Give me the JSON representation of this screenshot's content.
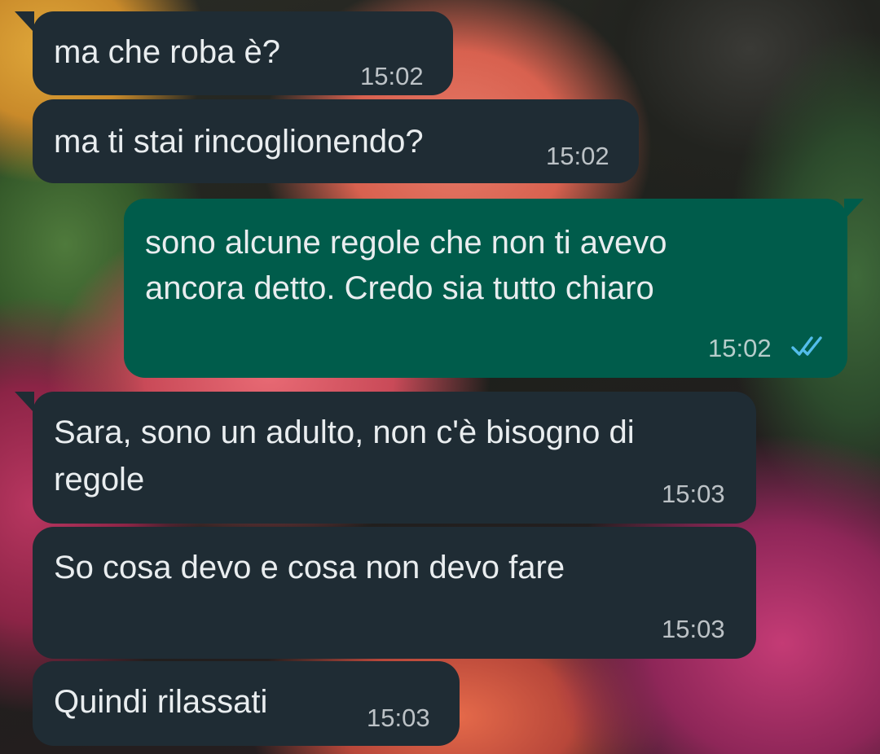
{
  "chat": {
    "messages": [
      {
        "direction": "in",
        "text_lines": [
          "ma che roba è?"
        ],
        "time": "15:02"
      },
      {
        "direction": "in",
        "text_lines": [
          "ma ti stai rincoglionendo?"
        ],
        "time": "15:02"
      },
      {
        "direction": "out",
        "text_lines": [
          "sono alcune regole che non ti avevo",
          "ancora detto. Credo sia tutto chiaro"
        ],
        "time": "15:02",
        "status": "read",
        "status_icon": "double-check-icon",
        "status_color": "#53bdeb"
      },
      {
        "direction": "in",
        "text_lines": [
          "Sara, sono un adulto, non c'è bisogno di",
          "regole"
        ],
        "time": "15:03"
      },
      {
        "direction": "in",
        "text_lines": [
          "So cosa devo e cosa non devo fare"
        ],
        "time": "15:03"
      },
      {
        "direction": "in",
        "text_lines": [
          "Quindi rilassati"
        ],
        "time": "15:03"
      }
    ]
  },
  "colors": {
    "incoming_bubble": "#1f2c34",
    "outgoing_bubble": "#005c4b",
    "text": "#e9edef",
    "read_ticks": "#53bdeb"
  }
}
